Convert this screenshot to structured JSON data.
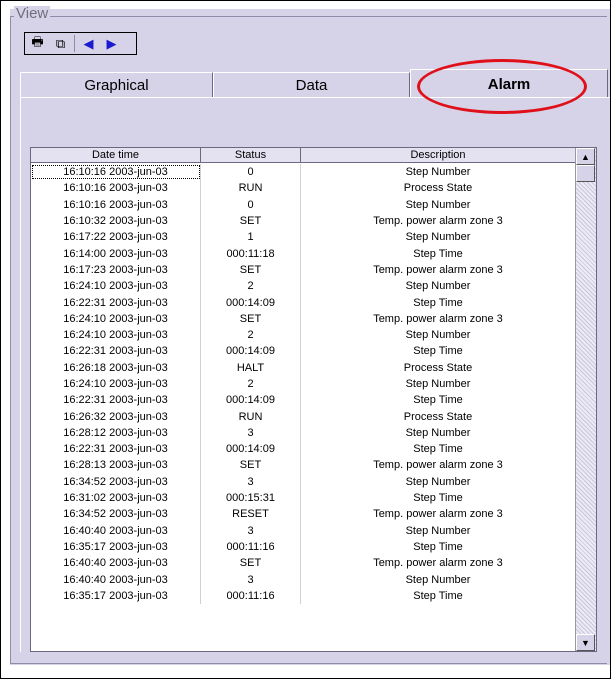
{
  "group": {
    "title": "View"
  },
  "toolbar": {
    "icons": [
      "printer-icon",
      "copy-icon",
      "left-arrow-icon",
      "right-arrow-icon"
    ],
    "glyphs": [
      "🖶",
      "⧉",
      "◀",
      "▶"
    ]
  },
  "tabs": [
    {
      "label": "Graphical"
    },
    {
      "label": "Data"
    },
    {
      "label": "Alarm"
    }
  ],
  "table": {
    "headers": [
      "Date time",
      "Status",
      "Description"
    ],
    "rows": [
      [
        "16:10:16 2003-jun-03",
        "0",
        "Step Number"
      ],
      [
        "16:10:16 2003-jun-03",
        "RUN",
        "Process State"
      ],
      [
        "16:10:16 2003-jun-03",
        "0",
        "Step Number"
      ],
      [
        "16:10:32 2003-jun-03",
        "SET",
        "Temp. power alarm zone 3"
      ],
      [
        "16:17:22 2003-jun-03",
        "1",
        "Step Number"
      ],
      [
        "16:14:00 2003-jun-03",
        "000:11:18",
        "Step Time"
      ],
      [
        "16:17:23 2003-jun-03",
        "SET",
        "Temp. power alarm zone 3"
      ],
      [
        "16:24:10 2003-jun-03",
        "2",
        "Step Number"
      ],
      [
        "16:22:31 2003-jun-03",
        "000:14:09",
        "Step Time"
      ],
      [
        "16:24:10 2003-jun-03",
        "SET",
        "Temp. power alarm zone 3"
      ],
      [
        "16:24:10 2003-jun-03",
        "2",
        "Step Number"
      ],
      [
        "16:22:31 2003-jun-03",
        "000:14:09",
        "Step Time"
      ],
      [
        "16:26:18 2003-jun-03",
        "HALT",
        "Process State"
      ],
      [
        "16:24:10 2003-jun-03",
        "2",
        "Step Number"
      ],
      [
        "16:22:31 2003-jun-03",
        "000:14:09",
        "Step Time"
      ],
      [
        "16:26:32 2003-jun-03",
        "RUN",
        "Process State"
      ],
      [
        "16:28:12 2003-jun-03",
        "3",
        "Step Number"
      ],
      [
        "16:22:31 2003-jun-03",
        "000:14:09",
        "Step Time"
      ],
      [
        "16:28:13 2003-jun-03",
        "SET",
        "Temp. power alarm zone 3"
      ],
      [
        "16:34:52 2003-jun-03",
        "3",
        "Step Number"
      ],
      [
        "16:31:02 2003-jun-03",
        "000:15:31",
        "Step Time"
      ],
      [
        "16:34:52 2003-jun-03",
        "RESET",
        "Temp. power alarm zone 3"
      ],
      [
        "16:40:40 2003-jun-03",
        "3",
        "Step Number"
      ],
      [
        "16:35:17 2003-jun-03",
        "000:11:16",
        "Step Time"
      ],
      [
        "16:40:40 2003-jun-03",
        "SET",
        "Temp. power alarm zone 3"
      ],
      [
        "16:40:40 2003-jun-03",
        "3",
        "Step Number"
      ],
      [
        "16:35:17 2003-jun-03",
        "000:11:16",
        "Step Time"
      ]
    ]
  },
  "scrollbar": {
    "up_glyph": "▲",
    "down_glyph": "▼"
  },
  "colors": {
    "panel": "#d6d3e8",
    "highlight": "#e0101a"
  }
}
